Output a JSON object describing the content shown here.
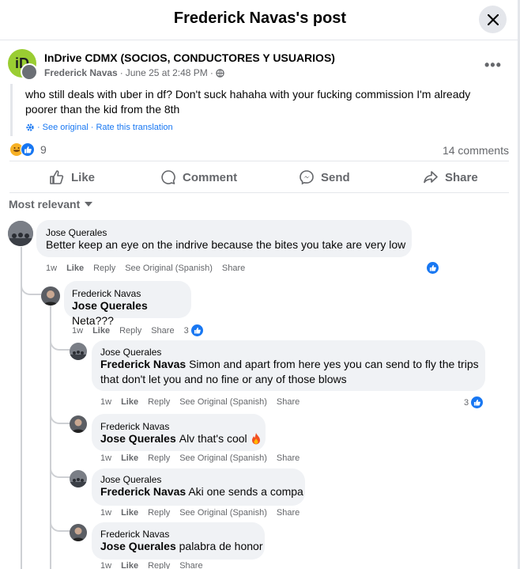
{
  "header": {
    "title": "Frederick Navas's post"
  },
  "post": {
    "group_name": "InDrive CDMX (SOCIOS, CONDUCTORES Y USUARIOS)",
    "author": "Frederick Navas",
    "date": "June 25 at 2:48 PM",
    "text_line1": "who still deals with uber in df? Don't suck hahaha with your fucking commission I'm already",
    "text_line2": "poorer than the kid from the 8th",
    "see_original": "See original",
    "rate_translation": "Rate this translation",
    "reaction_count": "9",
    "comments_count": "14 comments"
  },
  "actions": {
    "like": "Like",
    "comment": "Comment",
    "send": "Send",
    "share": "Share"
  },
  "filter": {
    "label": "Most relevant"
  },
  "labels": {
    "like": "Like",
    "reply": "Reply",
    "share": "Share",
    "see_original": "See Original (Spanish)"
  },
  "comments": [
    {
      "name": "Jose Querales",
      "mention": "",
      "text": "Better keep an eye on the indrive because the bites you take are very low",
      "time": "1w",
      "likes": ""
    },
    {
      "name": "Frederick Navas",
      "mention": "Jose Querales",
      "text": "Neta???",
      "time": "1w",
      "likes": "3"
    },
    {
      "name": "Jose Querales",
      "mention": "Frederick Navas",
      "text_line1": "Simon and apart from here yes you can send to fly the trips",
      "text_line2": "that don't let you and no fine or any of those blows",
      "time": "1w",
      "likes": "3"
    },
    {
      "name": "Frederick Navas",
      "mention": "Jose Querales",
      "text": "Alv that's cool",
      "time": "1w"
    },
    {
      "name": "Jose Querales",
      "mention": "Frederick Navas",
      "text": "Aki one sends a compa",
      "time": "1w"
    },
    {
      "name": "Frederick Navas",
      "mention": "Jose Querales",
      "text": "palabra de honor",
      "time": "1w"
    }
  ],
  "colors": {
    "accent": "#1877f2",
    "muted": "#65676b",
    "bubble": "#f0f2f5",
    "group_logo": "#9acd32"
  }
}
